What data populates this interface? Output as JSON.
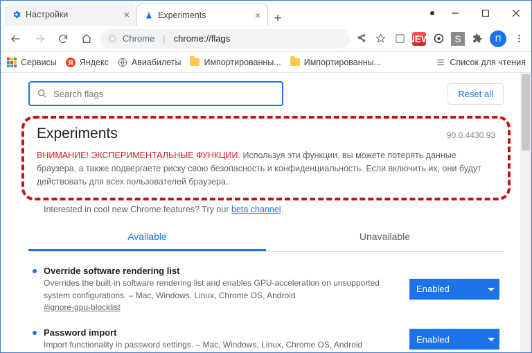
{
  "tabs": [
    {
      "title": "Настройки",
      "active": false
    },
    {
      "title": "Experiments",
      "active": true
    }
  ],
  "toolbar": {
    "url_host": "Chrome",
    "url_path": "chrome://flags",
    "avatar_letter": "П"
  },
  "extension_badge": "NEW",
  "extension_square": "S",
  "bookmarks": {
    "items": [
      {
        "label": "Сервисы",
        "icon": "apps"
      },
      {
        "label": "Яндекс",
        "icon": "yandex"
      },
      {
        "label": "Авиабилеты",
        "icon": "globe"
      },
      {
        "label": "Импортированны...",
        "icon": "folder"
      },
      {
        "label": "Импортированны...",
        "icon": "folder"
      }
    ],
    "reading_list": "Список для чтения"
  },
  "search": {
    "placeholder": "Search flags"
  },
  "reset_all": "Reset all",
  "header": {
    "title": "Experiments",
    "version": "90.0.4430.93"
  },
  "warning": {
    "lead": "ВНИМАНИЕ! ЭКСПЕРИМЕНТАЛЬНЫЕ ФУНКЦИИ.",
    "body": " Используя эти функции, вы можете потерять данные браузера, а также подвергаете риску свою безопасность и конфиденциальность. Если включить их, они будут действовать для всех пользователей браузера."
  },
  "beta": {
    "text": "Interested in cool new Chrome features? Try our ",
    "link": "beta channel",
    "suffix": "."
  },
  "page_tabs": {
    "available": "Available",
    "unavailable": "Unavailable"
  },
  "flags": [
    {
      "title": "Override software rendering list",
      "desc": "Overrides the built-in software rendering list and enables GPU-acceleration on unsupported system configurations. – Mac, Windows, Linux, Chrome OS, Android",
      "hash": "#ignore-gpu-blocklist",
      "value": "Enabled"
    },
    {
      "title": "Password import",
      "desc": "Import functionality in password settings. – Mac, Windows, Linux, Chrome OS, Android",
      "hash": "",
      "value": "Enabled"
    }
  ]
}
